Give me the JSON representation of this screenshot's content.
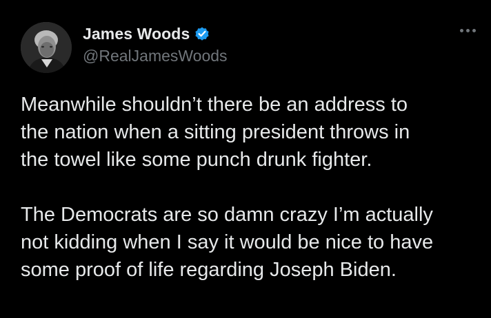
{
  "author": {
    "display_name": "James Woods",
    "handle": "@RealJamesWoods",
    "verified": true,
    "avatar_icon": "profile-photo"
  },
  "menu": {
    "icon": "more-horizontal-icon"
  },
  "tweet": {
    "paragraphs": [
      {
        "lines": [
          "Meanwhile shouldn’t there be an address to",
          "the nation when a sitting president throws in",
          "the towel like some punch drunk fighter."
        ]
      },
      {
        "lines": [
          "The Democrats are so damn crazy I’m actually",
          "not kidding when I say it would be nice to have",
          "some proof of life regarding Joseph Biden."
        ]
      }
    ]
  },
  "colors": {
    "background": "#000000",
    "text_primary": "#e7e9ea",
    "text_secondary": "#71767b",
    "verified_badge": "#1d9bf0"
  }
}
